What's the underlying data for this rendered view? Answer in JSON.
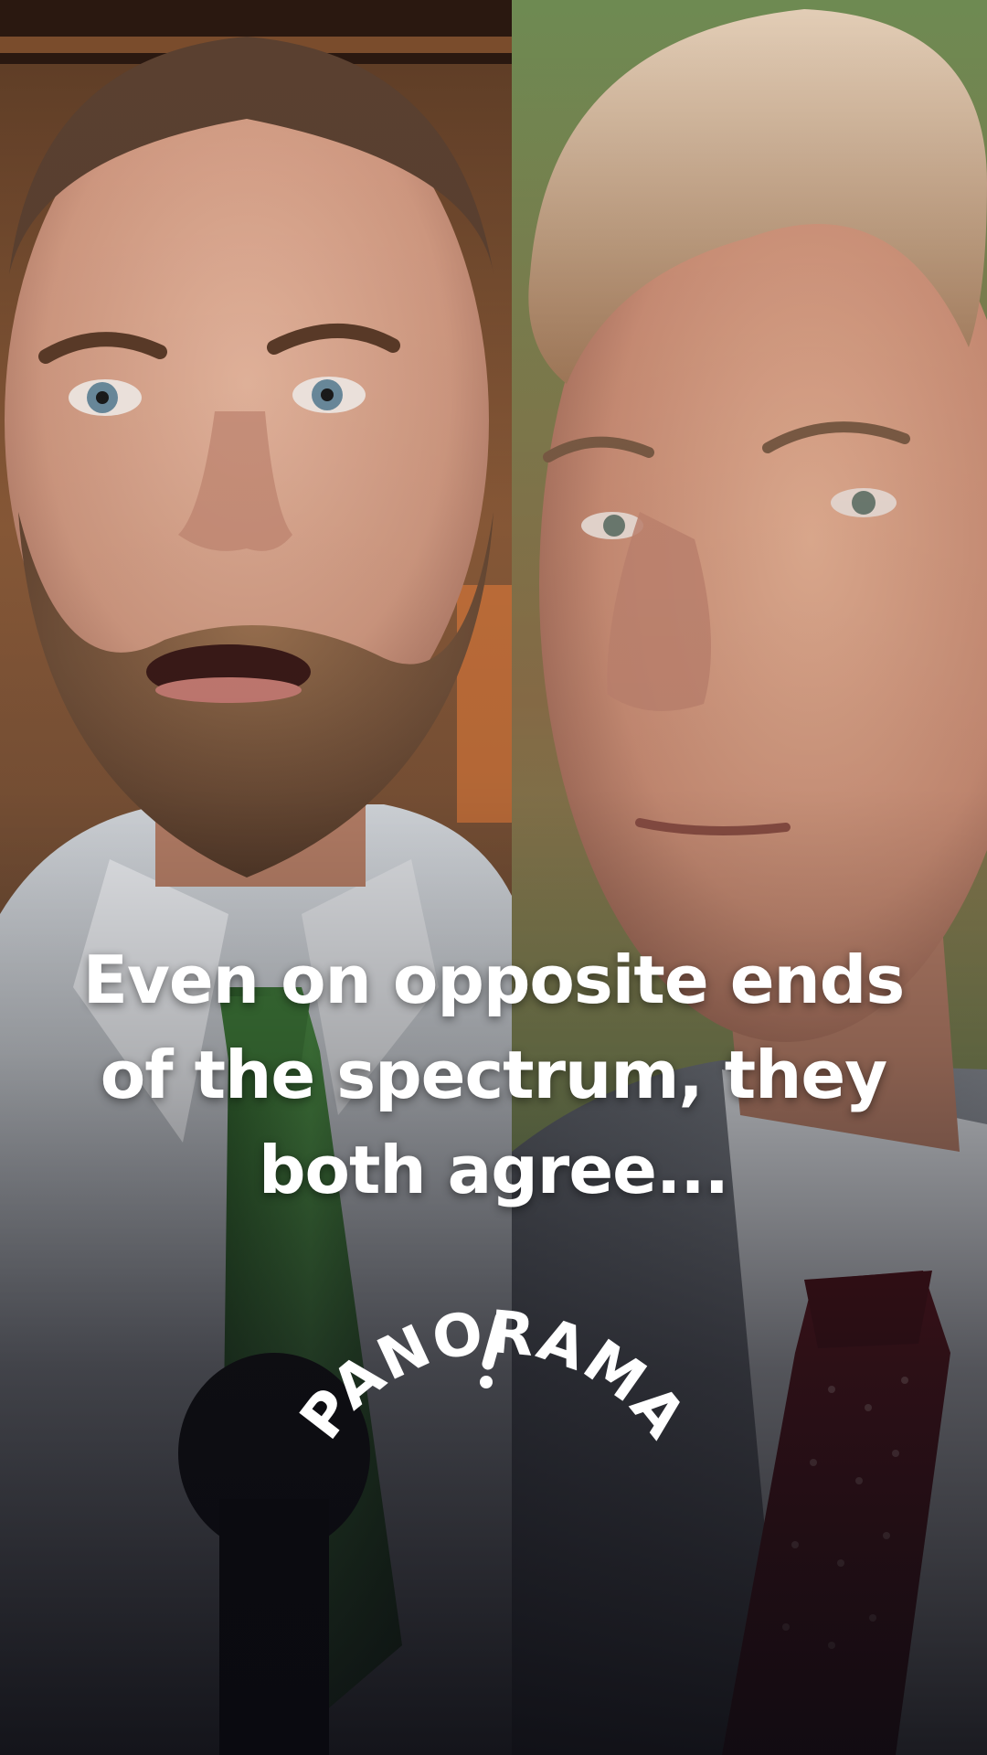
{
  "headline": "Even on opposite ends of the spectrum, they both agree...",
  "brand": {
    "name": "PANORAMA",
    "text_color": "#ffffff"
  },
  "subjects": [
    {
      "description": "bearded man, white shirt, green tie, microphone",
      "tie_color": "#3e7a3a"
    },
    {
      "description": "older man, grey-white hair, grey suit, dark red tie",
      "tie_color": "#6b1a22"
    }
  ],
  "colors": {
    "overlay_bottom": "#0c0c10",
    "text": "#ffffff"
  }
}
